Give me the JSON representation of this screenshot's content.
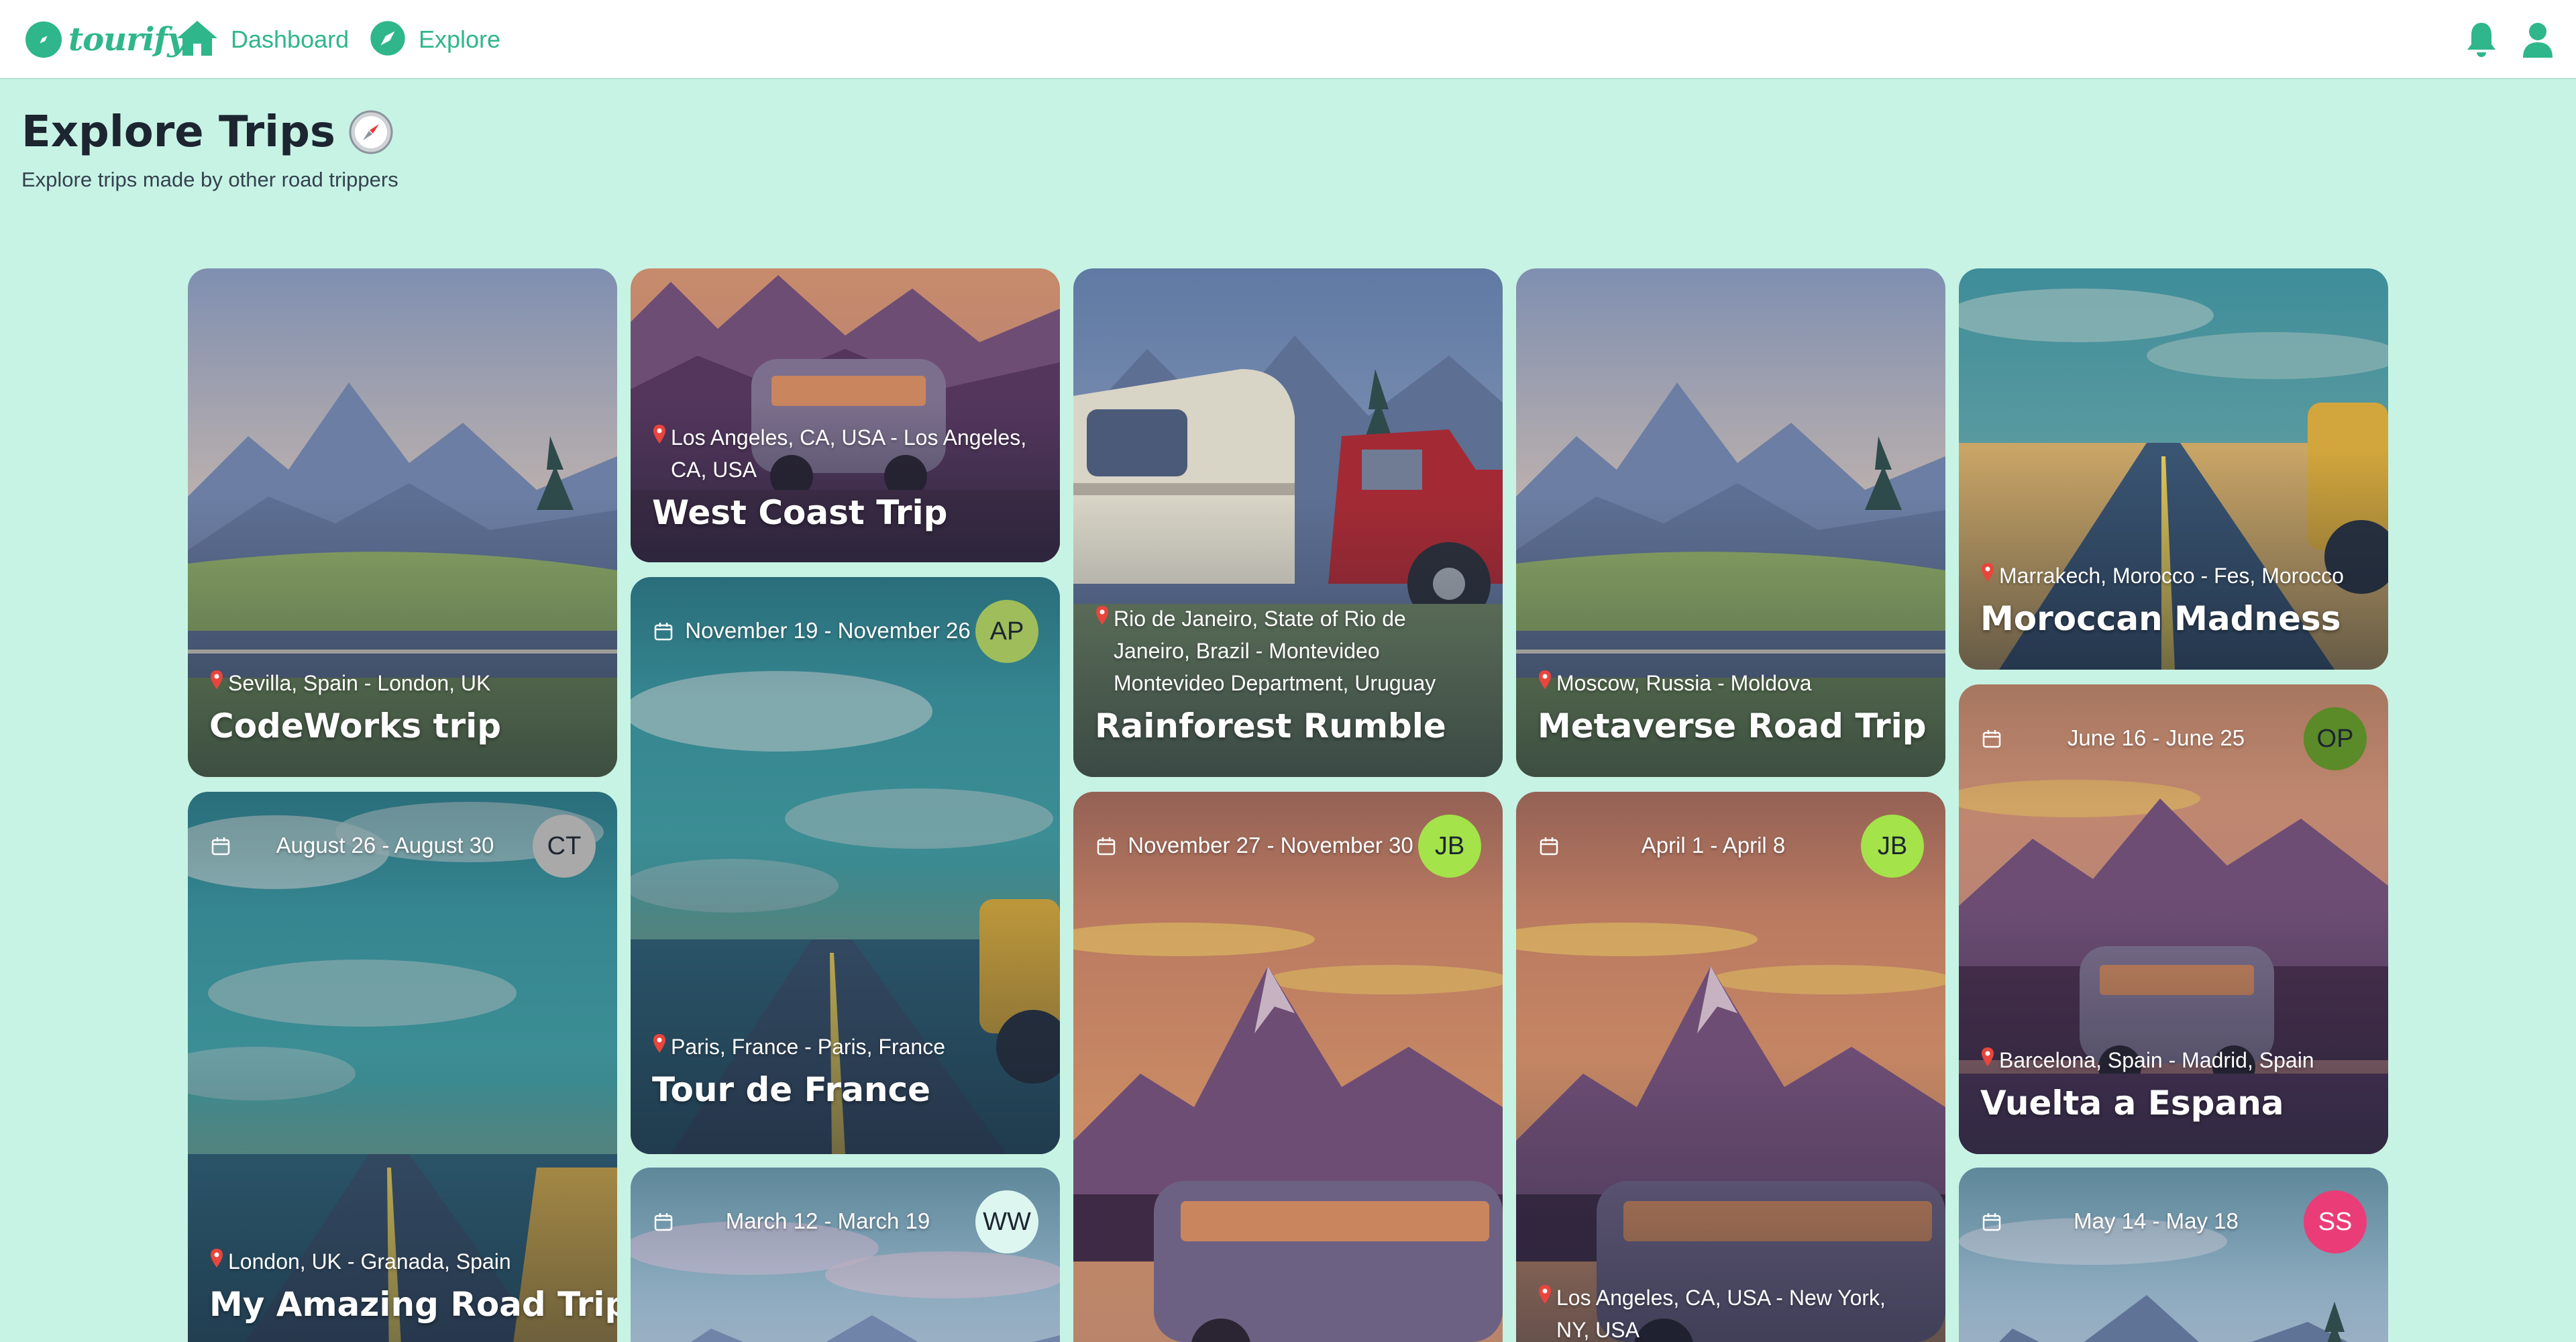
{
  "app": {
    "name": "tourify"
  },
  "nav": {
    "dashboard": "Dashboard",
    "explore": "Explore"
  },
  "icons": {
    "bell": "bell-icon",
    "user": "user-icon",
    "home": "home-icon",
    "compass": "compass-icon",
    "pin": "pin-icon",
    "calendar": "calendar-icon"
  },
  "colors": {
    "brand": "#2fb68a",
    "page_bg": "#c7f3e5",
    "title": "#1c2530"
  },
  "page": {
    "title": "Explore Trips",
    "subtitle": "Explore trips made by other road trippers"
  },
  "cards": [
    {
      "title": "CodeWorks trip",
      "location": "Sevilla, Spain - London, UK",
      "scene": "mountain"
    },
    {
      "title": "West Coast Trip",
      "location": "Los Angeles, CA, USA - Los Angeles, CA, USA",
      "scene": "van-purple"
    },
    {
      "title": "Rainforest Rumble",
      "location": "Rio de Janeiro, State of Rio de Janeiro, Brazil - Montevideo Montevideo Department, Uruguay",
      "scene": "trailer"
    },
    {
      "title": "Metaverse Road Trip",
      "location": "Moscow, Russia - Moldova",
      "scene": "mountain"
    },
    {
      "title": "Moroccan Madness",
      "location": "Marrakech, Morocco - Fes, Morocco",
      "scene": "road-jeep"
    },
    {
      "title": "",
      "location": "",
      "dates": "August 26 - August 30",
      "initials": "CT",
      "avatar_color": "#a9a9a9",
      "scene": "road-cloud"
    },
    {
      "title": "Tour de France",
      "location": "Paris, France - Paris, France",
      "dates": "November 19 - November 26",
      "initials": "AP",
      "avatar_color": "#9fbd5a",
      "scene": "road-cloud"
    },
    {
      "title": "",
      "location": "",
      "dates": "November 27 - November 30",
      "initials": "JB",
      "avatar_color": "#a4e34a",
      "scene": "van-sunset"
    },
    {
      "title": "",
      "location": "Los Angeles, CA, USA - New York, NY, USA",
      "dates": "April 1 - April 8",
      "initials": "JB",
      "avatar_color": "#a4e34a",
      "scene": "van-sunset"
    },
    {
      "title": "Vuelta a Espana",
      "location": "Barcelona, Spain - Madrid, Spain",
      "dates": "June 16 - June 25",
      "initials": "OP",
      "avatar_color": "#5b8a28",
      "scene": "van-purple"
    },
    {
      "title": "My Amazing Road Trip",
      "location": "London, UK - Granada, Spain",
      "scene": "road-cloud"
    },
    {
      "title": "",
      "location": "",
      "dates": "March 12 - March 19",
      "initials": "WW",
      "avatar_color": "#ddf6f0",
      "scene": "mountain-pale"
    },
    {
      "title": "",
      "location": "",
      "dates": "May 14 - May 18",
      "initials": "SS",
      "avatar_color": "#ea3d78",
      "scene": "mountain-pale"
    }
  ]
}
